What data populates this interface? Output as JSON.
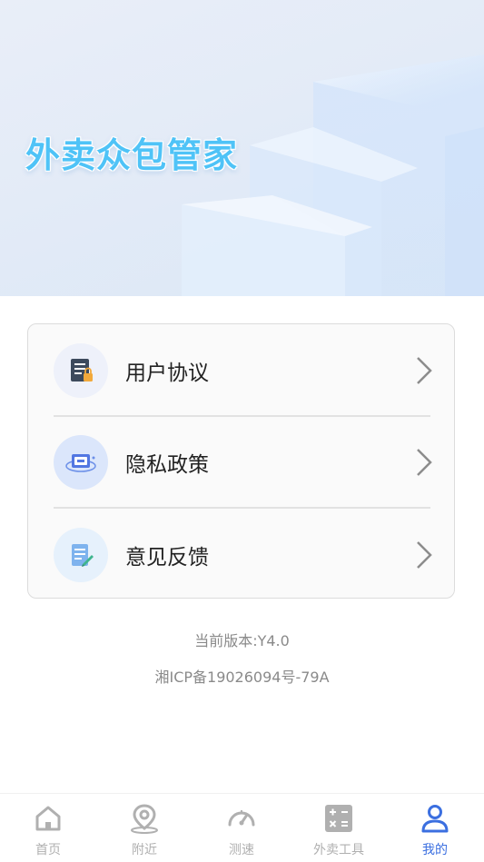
{
  "hero": {
    "title": "外卖众包管家"
  },
  "menu": {
    "items": [
      {
        "label": "用户协议",
        "icon": "document-lock-icon"
      },
      {
        "label": "隐私政策",
        "icon": "privacy-shield-icon"
      },
      {
        "label": "意见反馈",
        "icon": "feedback-edit-icon"
      }
    ]
  },
  "footer": {
    "version": "当前版本:Y4.0",
    "icp": "湘ICP备19026094号-79A"
  },
  "tabbar": {
    "tabs": [
      {
        "label": "首页",
        "icon": "home-icon",
        "active": false
      },
      {
        "label": "附近",
        "icon": "location-pin-icon",
        "active": false
      },
      {
        "label": "测速",
        "icon": "speedometer-icon",
        "active": false
      },
      {
        "label": "外卖工具",
        "icon": "calculator-icon",
        "active": false
      },
      {
        "label": "我的",
        "icon": "user-icon",
        "active": true
      }
    ]
  },
  "colors": {
    "accent": "#3b6fe0",
    "hero_title": "#4fc3f7",
    "tab_inactive": "#b0b0b0",
    "muted_text": "#8a8a8a"
  }
}
